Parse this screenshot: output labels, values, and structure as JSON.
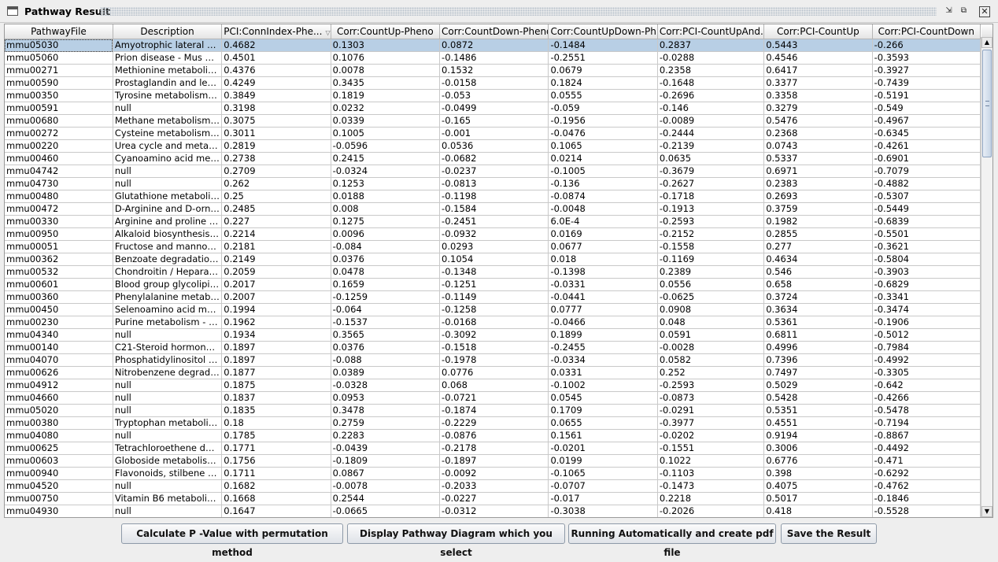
{
  "window": {
    "title": "Pathway Result"
  },
  "columns": [
    "PathwayFile",
    "Description",
    "PCI:ConnIndex-Phe...",
    "Corr:CountUp-Pheno",
    "Corr:CountDown-Pheno",
    "Corr:CountUpDown-Ph...",
    "Corr:PCI-CountUpAnd...",
    "Corr:PCI-CountUp",
    "Corr:PCI-CountDown"
  ],
  "sort_indicator": "▽",
  "rows": [
    [
      "mmu05030",
      "Amyotrophic lateral scl...",
      "0.4682",
      "0.1303",
      "0.0872",
      "-0.1484",
      "0.2837",
      "0.5443",
      "-0.266"
    ],
    [
      "mmu05060",
      "Prion disease - Mus m...",
      "0.4501",
      "0.1076",
      "-0.1486",
      "-0.2551",
      "-0.0288",
      "0.4546",
      "-0.3593"
    ],
    [
      "mmu00271",
      "Methionine metabolis...",
      "0.4376",
      "0.0078",
      "0.1532",
      "0.0679",
      "0.2358",
      "0.6417",
      "-0.3927"
    ],
    [
      "mmu00590",
      "Prostaglandin and leu...",
      "0.4249",
      "0.3435",
      "-0.0158",
      "0.1824",
      "-0.1648",
      "0.3377",
      "-0.7439"
    ],
    [
      "mmu00350",
      "Tyrosine metabolism - ...",
      "0.3849",
      "0.1819",
      "-0.053",
      "0.0555",
      "-0.2696",
      "0.3358",
      "-0.5191"
    ],
    [
      "mmu00591",
      "null",
      "0.3198",
      "0.0232",
      "-0.0499",
      "-0.059",
      "-0.146",
      "0.3279",
      "-0.549"
    ],
    [
      "mmu00680",
      "Methane metabolism - ...",
      "0.3075",
      "0.0339",
      "-0.165",
      "-0.1956",
      "-0.0089",
      "0.5476",
      "-0.4967"
    ],
    [
      "mmu00272",
      "Cysteine metabolism -...",
      "0.3011",
      "0.1005",
      "-0.001",
      "-0.0476",
      "-0.2444",
      "0.2368",
      "-0.6345"
    ],
    [
      "mmu00220",
      "Urea cycle and metabo...",
      "0.2819",
      "-0.0596",
      "0.0536",
      "0.1065",
      "-0.2139",
      "0.0743",
      "-0.4261"
    ],
    [
      "mmu00460",
      "Cyanoamino acid met...",
      "0.2738",
      "0.2415",
      "-0.0682",
      "0.0214",
      "0.0635",
      "0.5337",
      "-0.6901"
    ],
    [
      "mmu04742",
      "null",
      "0.2709",
      "-0.0324",
      "-0.0237",
      "-0.1005",
      "-0.3679",
      "0.6971",
      "-0.7079"
    ],
    [
      "mmu04730",
      "null",
      "0.262",
      "0.1253",
      "-0.0813",
      "-0.136",
      "-0.2627",
      "0.2383",
      "-0.4882"
    ],
    [
      "mmu00480",
      "Glutathione metabolis...",
      "0.25",
      "0.0188",
      "-0.1198",
      "-0.0874",
      "-0.1718",
      "0.2693",
      "-0.5307"
    ],
    [
      "mmu00472",
      "D-Arginine and D-ornit...",
      "0.2485",
      "0.008",
      "-0.1584",
      "-0.0048",
      "-0.1913",
      "0.3759",
      "-0.5449"
    ],
    [
      "mmu00330",
      "Arginine and proline m...",
      "0.227",
      "0.1275",
      "-0.2451",
      "6.0E-4",
      "-0.2593",
      "0.1982",
      "-0.6839"
    ],
    [
      "mmu00950",
      "Alkaloid biosynthesis I ...",
      "0.2214",
      "0.0096",
      "-0.0932",
      "0.0169",
      "-0.2152",
      "0.2855",
      "-0.5501"
    ],
    [
      "mmu00051",
      "Fructose and mannos...",
      "0.2181",
      "-0.084",
      "0.0293",
      "0.0677",
      "-0.1558",
      "0.277",
      "-0.3621"
    ],
    [
      "mmu00362",
      "Benzoate degradation ...",
      "0.2149",
      "0.0376",
      "0.1054",
      "0.018",
      "-0.1169",
      "0.4634",
      "-0.5804"
    ],
    [
      "mmu00532",
      "Chondroitin / Heparan ...",
      "0.2059",
      "0.0478",
      "-0.1348",
      "-0.1398",
      "0.2389",
      "0.546",
      "-0.3903"
    ],
    [
      "mmu00601",
      "Blood group glycolipid ...",
      "0.2017",
      "0.1659",
      "-0.1251",
      "-0.0331",
      "0.0556",
      "0.658",
      "-0.6829"
    ],
    [
      "mmu00360",
      "Phenylalanine metabol...",
      "0.2007",
      "-0.1259",
      "-0.1149",
      "-0.0441",
      "-0.0625",
      "0.3724",
      "-0.3341"
    ],
    [
      "mmu00450",
      "Selenoamino acid met...",
      "0.1994",
      "-0.064",
      "-0.1258",
      "0.0777",
      "0.0908",
      "0.3634",
      "-0.3474"
    ],
    [
      "mmu00230",
      "Purine metabolism - M...",
      "0.1962",
      "-0.1537",
      "-0.0168",
      "-0.0466",
      "0.048",
      "0.5361",
      "-0.1906"
    ],
    [
      "mmu04340",
      "null",
      "0.1934",
      "0.3565",
      "-0.3092",
      "0.1899",
      "0.0591",
      "0.6811",
      "-0.5012"
    ],
    [
      "mmu00140",
      "C21-Steroid hormone ...",
      "0.1897",
      "0.0376",
      "-0.1518",
      "-0.2455",
      "-0.0028",
      "0.4996",
      "-0.7984"
    ],
    [
      "mmu04070",
      "Phosphatidylinositol si...",
      "0.1897",
      "-0.088",
      "-0.1978",
      "-0.0334",
      "0.0582",
      "0.7396",
      "-0.4992"
    ],
    [
      "mmu00626",
      "Nitrobenzene degradat...",
      "0.1877",
      "0.0389",
      "0.0776",
      "0.0331",
      "0.252",
      "0.7497",
      "-0.3305"
    ],
    [
      "mmu04912",
      "null",
      "0.1875",
      "-0.0328",
      "0.068",
      "-0.1002",
      "-0.2593",
      "0.5029",
      "-0.642"
    ],
    [
      "mmu04660",
      "null",
      "0.1837",
      "0.0953",
      "-0.0721",
      "0.0545",
      "-0.0873",
      "0.5428",
      "-0.4266"
    ],
    [
      "mmu05020",
      "null",
      "0.1835",
      "0.3478",
      "-0.1874",
      "0.1709",
      "-0.0291",
      "0.5351",
      "-0.5478"
    ],
    [
      "mmu00380",
      "Tryptophan metabolis...",
      "0.18",
      "0.2759",
      "-0.2229",
      "0.0655",
      "-0.3977",
      "0.4551",
      "-0.7194"
    ],
    [
      "mmu04080",
      "null",
      "0.1785",
      "0.2283",
      "-0.0876",
      "0.1561",
      "-0.0202",
      "0.9194",
      "-0.8867"
    ],
    [
      "mmu00625",
      "Tetrachloroethene deg...",
      "0.1771",
      "-0.0439",
      "-0.2178",
      "-0.0201",
      "-0.1551",
      "0.3006",
      "-0.4492"
    ],
    [
      "mmu00603",
      "Globoside metabolism...",
      "0.1756",
      "-0.1809",
      "-0.1897",
      "0.0199",
      "0.1022",
      "0.6776",
      "-0.471"
    ],
    [
      "mmu00940",
      "Flavonoids, stilbene a...",
      "0.1711",
      "0.0867",
      "-0.0092",
      "-0.1065",
      "-0.1103",
      "0.398",
      "-0.6292"
    ],
    [
      "mmu04520",
      "null",
      "0.1682",
      "-0.0078",
      "-0.2033",
      "-0.0707",
      "-0.1473",
      "0.4075",
      "-0.4762"
    ],
    [
      "mmu00750",
      "Vitamin B6 metabolis...",
      "0.1668",
      "0.2544",
      "-0.0227",
      "-0.017",
      "0.2218",
      "0.5017",
      "-0.1846"
    ],
    [
      "mmu04930",
      "null",
      "0.1647",
      "-0.0665",
      "-0.0312",
      "-0.3038",
      "-0.2026",
      "0.418",
      "-0.5528"
    ]
  ],
  "selected_row": 0,
  "buttons": {
    "calc": "Calculate P -Value with permutation method",
    "display": "Display Pathway Diagram which you select",
    "auto": "Running Automatically and create pdf file",
    "save": "Save the Result"
  },
  "icons": {
    "restore": "restore-icon",
    "maximize": "maximize-icon",
    "close": "close-icon"
  },
  "colors": {
    "selection": "#b8cfe5",
    "grid": "#c9c9c9"
  }
}
